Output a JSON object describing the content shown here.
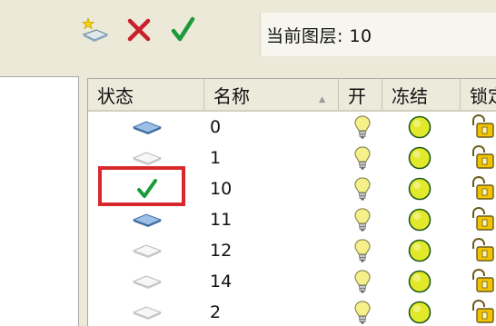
{
  "toolbar": {
    "new_layer_icon": "new-layer-icon",
    "delete_layer_icon": "delete-layer-icon",
    "set_current_icon": "set-current-icon",
    "current_layer_text": "当前图层: 10"
  },
  "columns": {
    "status": "状态",
    "name": "名称",
    "on": "开",
    "freeze": "冻结",
    "lock": "锁定"
  },
  "rows": [
    {
      "status": "layer-icon-blue",
      "name": "0"
    },
    {
      "status": "layer-icon-white",
      "name": "1"
    },
    {
      "status": "current-check-icon",
      "name": "10"
    },
    {
      "status": "layer-icon-blue",
      "name": "11"
    },
    {
      "status": "layer-icon-white",
      "name": "12"
    },
    {
      "status": "layer-icon-white",
      "name": "14"
    },
    {
      "status": "layer-icon-white",
      "name": "2"
    }
  ],
  "colors": {
    "check_green": "#1a9a3a",
    "delete_red": "#c8202a",
    "highlight_red": "#d8282e",
    "bulb_yellow": "#f5f08a",
    "sun_yellow": "#e2e82a",
    "lock_yellow": "#f2c400"
  }
}
